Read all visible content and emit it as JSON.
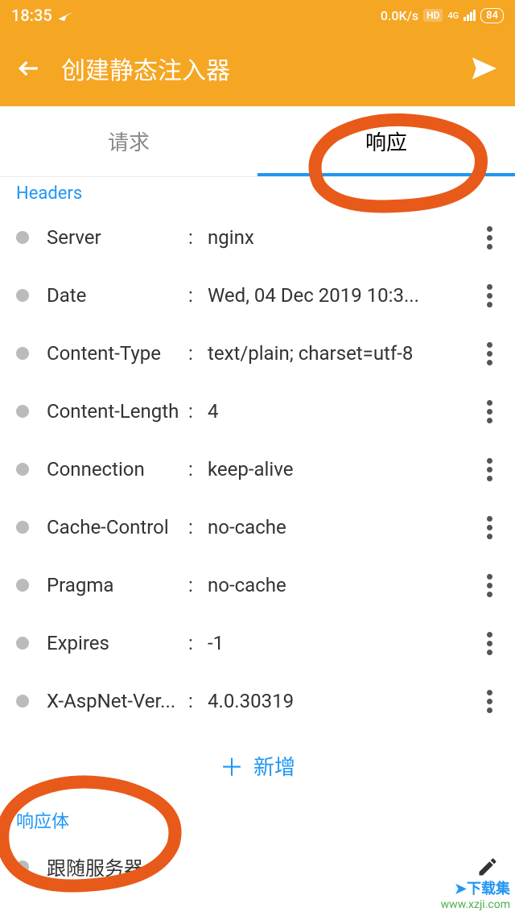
{
  "status": {
    "time": "18:35",
    "speed": "0.0K/s",
    "hd": "HD",
    "net_top": "4G",
    "net_bot": "it",
    "battery": "84"
  },
  "appbar": {
    "title": "创建静态注入器"
  },
  "tabs": {
    "request": "请求",
    "response": "响应"
  },
  "sections": {
    "headers": "Headers",
    "body": "响应体"
  },
  "headers": [
    {
      "key": "Server",
      "value": "nginx"
    },
    {
      "key": "Date",
      "value": "Wed, 04 Dec 2019 10:3..."
    },
    {
      "key": "Content-Type",
      "value": "text/plain; charset=utf-8"
    },
    {
      "key": "Content-Length",
      "value": "4"
    },
    {
      "key": "Connection",
      "value": "keep-alive"
    },
    {
      "key": "Cache-Control",
      "value": "no-cache"
    },
    {
      "key": "Pragma",
      "value": "no-cache"
    },
    {
      "key": "Expires",
      "value": "-1"
    },
    {
      "key": "X-AspNet-Ver...",
      "value": "4.0.30319"
    }
  ],
  "add_label": "新增",
  "body_mode": "跟随服务器",
  "watermark": {
    "top": "下载集",
    "bottom": "www.xzji.com"
  },
  "colors": {
    "accent": "#f5a623",
    "link": "#2196f3",
    "annotation": "#e85a1a"
  }
}
